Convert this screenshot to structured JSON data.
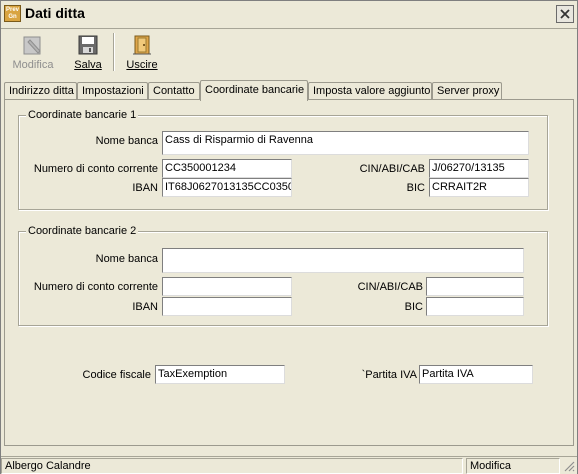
{
  "window": {
    "title": "Dati ditta",
    "app_icon_text": "Prev Gn"
  },
  "toolbar": {
    "modifica_label": "Modifica",
    "salva_label": "Salva",
    "uscire_label": "Uscire"
  },
  "tabs": [
    {
      "label": "Indirizzo ditta"
    },
    {
      "label": "Impostazioni"
    },
    {
      "label": "Contatto"
    },
    {
      "label": "Coordinate bancarie"
    },
    {
      "label": "Imposta valore aggiunto"
    },
    {
      "label": "Server proxy"
    }
  ],
  "group1": {
    "title": "Coordinate bancarie 1",
    "nome_banca_label": "Nome banca",
    "nome_banca_value": "Cass di Risparmio di Ravenna",
    "conto_label": "Numero di conto corrente",
    "conto_value": "CC350001234",
    "cin_label": "CIN/ABI/CAB",
    "cin_value": "J/06270/13135",
    "iban_label": "IBAN",
    "iban_value": "IT68J0627013135CC0350",
    "bic_label": "BIC",
    "bic_value": "CRRAIT2R"
  },
  "group2": {
    "title": "Coordinate bancarie 2",
    "nome_banca_label": "Nome banca",
    "nome_banca_value": "",
    "conto_label": "Numero di conto corrente",
    "conto_value": "",
    "cin_label": "CIN/ABI/CAB",
    "cin_value": "",
    "iban_label": "IBAN",
    "iban_value": "",
    "bic_label": "BIC",
    "bic_value": ""
  },
  "fiscal": {
    "codice_label": "Codice fiscale",
    "codice_value": "TaxExemption",
    "partita_label": "`Partita IVA",
    "partita_value": "Partita IVA"
  },
  "status": {
    "user": "Albergo Calandre",
    "mode": "Modifica"
  }
}
